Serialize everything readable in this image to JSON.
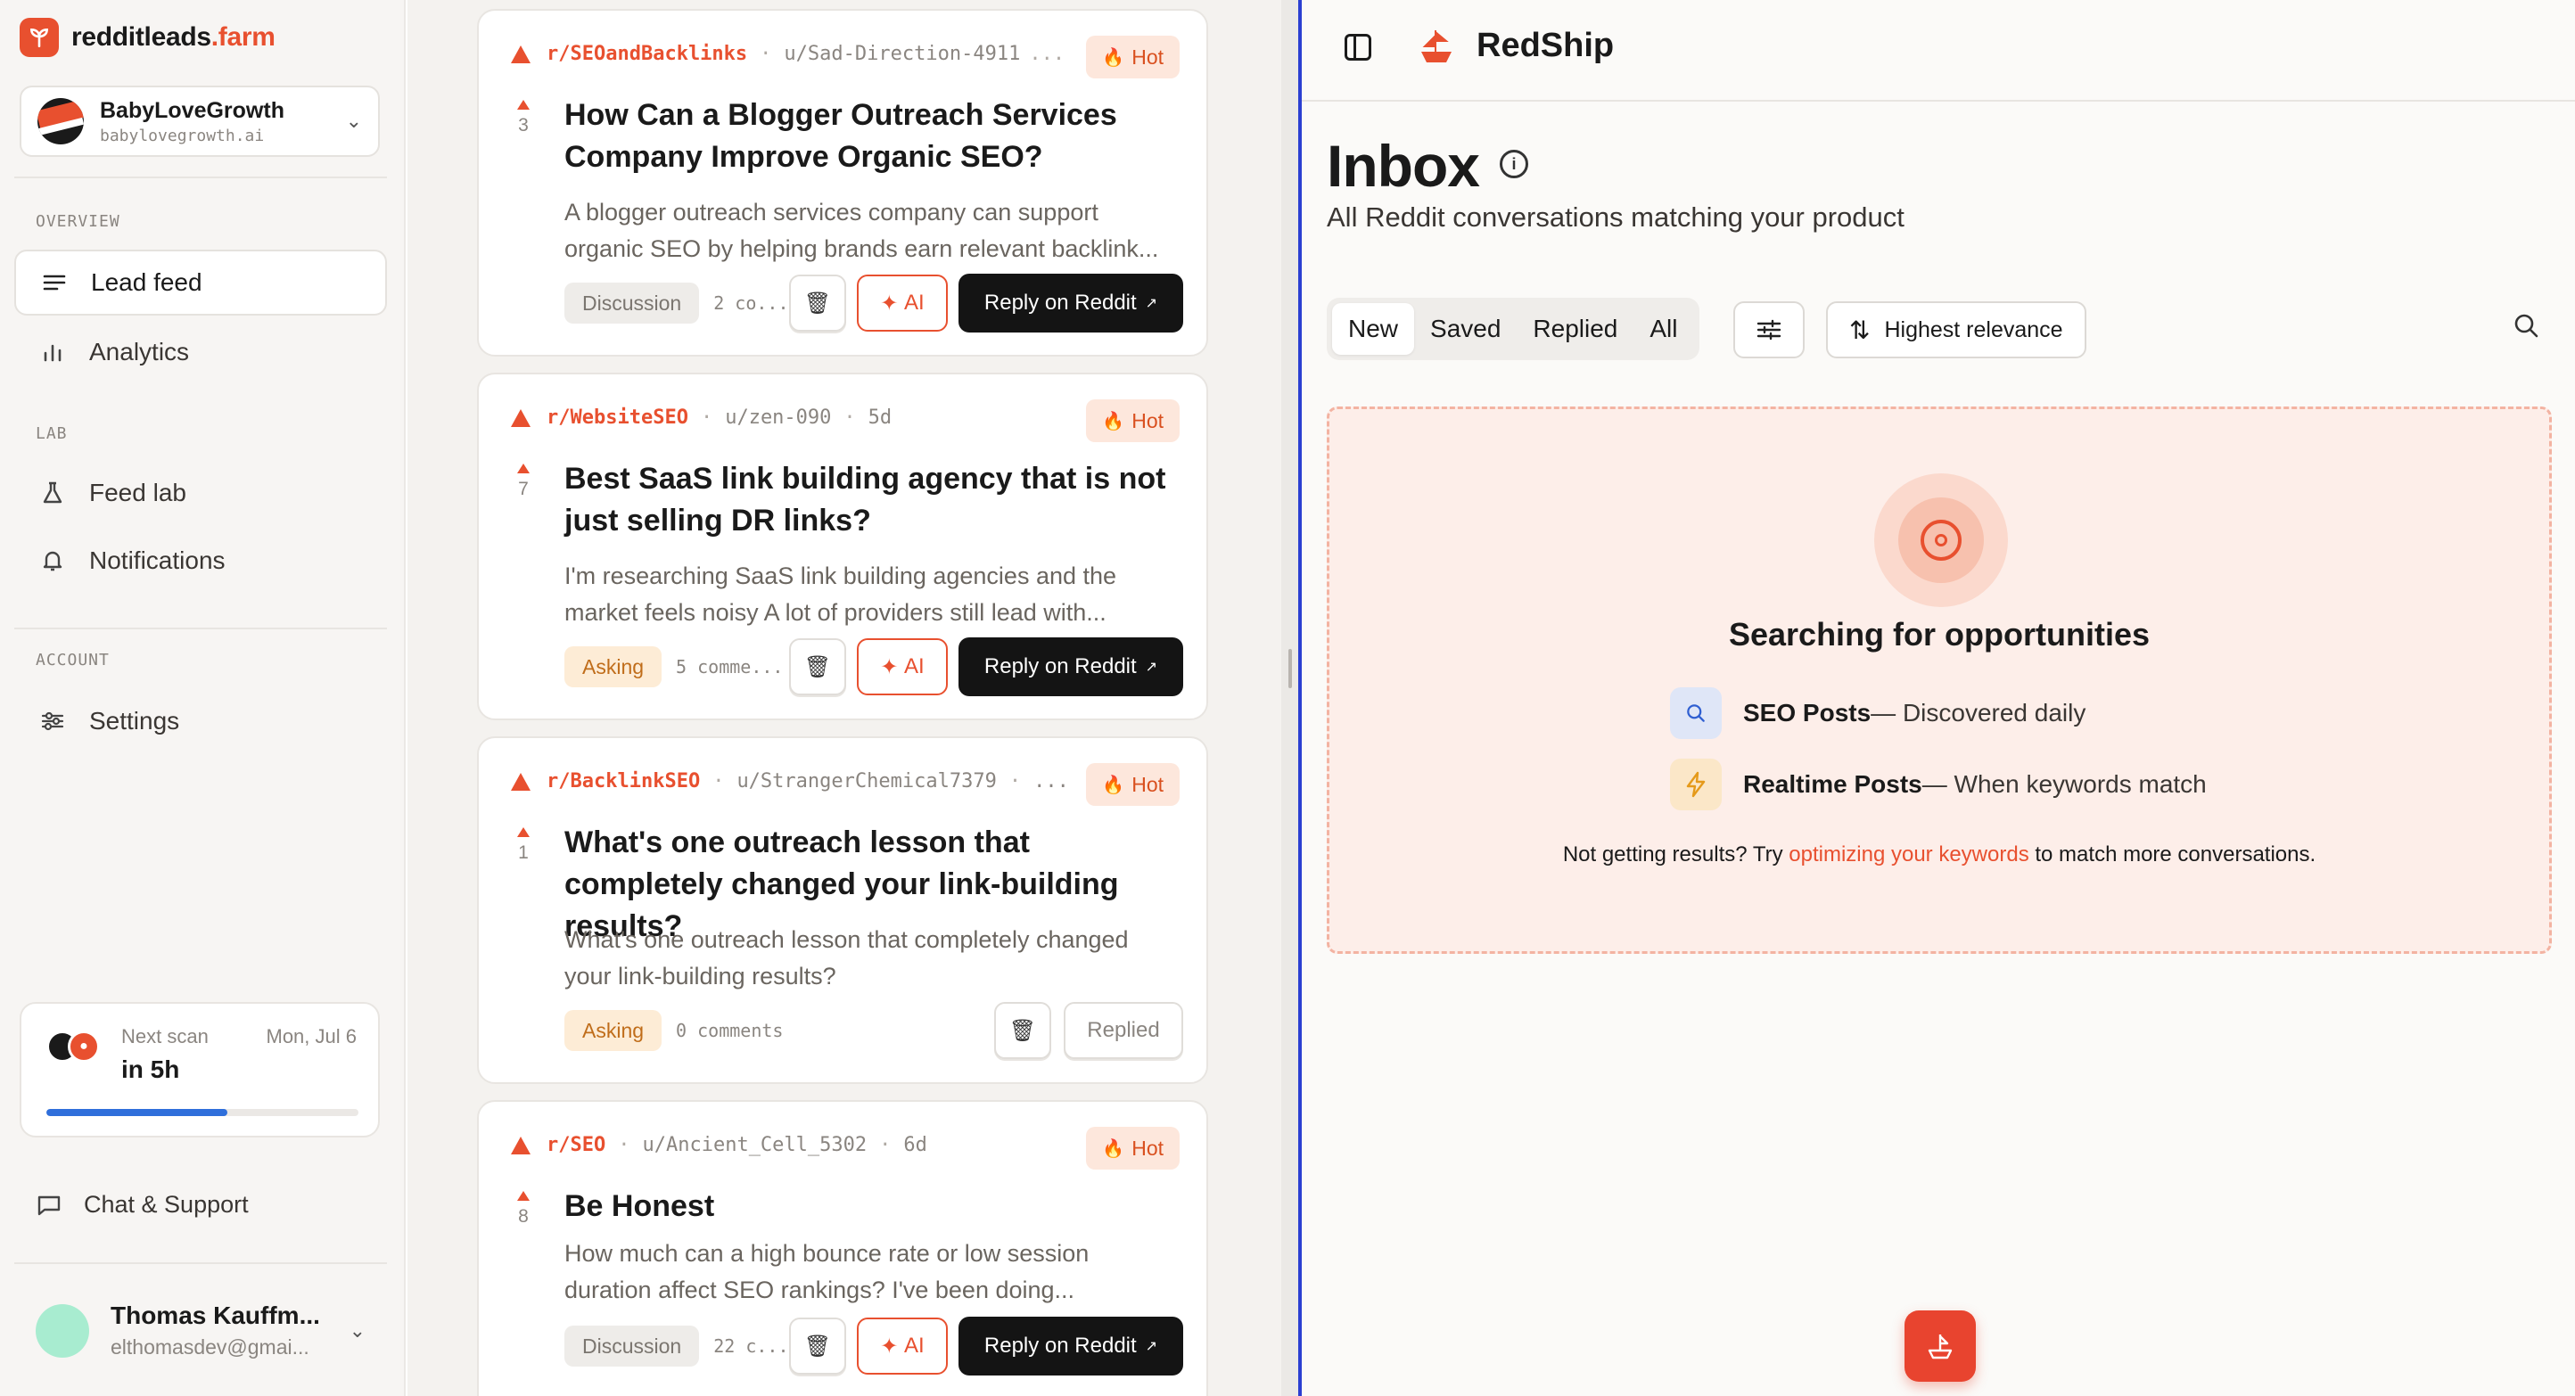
{
  "brand": {
    "name_main": "redditleads",
    "name_accent": ".farm"
  },
  "project": {
    "name": "BabyLoveGrowth",
    "domain": "babylovegrowth.ai"
  },
  "sidebar": {
    "overview_label": "OVERVIEW",
    "lab_label": "LAB",
    "account_label": "ACCOUNT",
    "items": {
      "lead_feed": "Lead feed",
      "analytics": "Analytics",
      "feed_lab": "Feed lab",
      "notifications": "Notifications",
      "settings": "Settings"
    },
    "support": "Chat & Support"
  },
  "scan": {
    "label": "Next scan",
    "date": "Mon, Jul 6",
    "value": "in 5h",
    "progress": 0.58
  },
  "user": {
    "name": "Thomas Kauffm...",
    "email": "elthomasdev@gmai..."
  },
  "posts": [
    {
      "subreddit": "r/SEOandBacklinks",
      "author": "u/Sad-Direction-4911",
      "age": "",
      "hot": "Hot",
      "votes": "3",
      "title": "How Can a Blogger Outreach Services Company Improve Organic SEO?",
      "body": "A blogger outreach services company can support organic SEO by helping brands earn relevant backlink...",
      "tag": "Discussion",
      "comments": "2 co...",
      "ai": "AI",
      "reply": "Reply on Reddit"
    },
    {
      "subreddit": "r/WebsiteSEO",
      "author": "u/zen-090",
      "age": "5d",
      "hot": "Hot",
      "votes": "7",
      "title": "Best SaaS link building agency that is not just selling DR links?",
      "body": "I'm researching SaaS link building agencies and the market feels noisy A lot of providers still lead with...",
      "tag": "Asking",
      "comments": "5 comme...",
      "ai": "AI",
      "reply": "Reply on Reddit"
    },
    {
      "subreddit": "r/BacklinkSEO",
      "author": "u/StrangerChemical7379",
      "age": "",
      "hot": "Hot",
      "votes": "1",
      "title": "What's one outreach lesson that completely changed your link-building results?",
      "body": "What's one outreach lesson that completely changed your link-building results?",
      "tag": "Asking",
      "comments": "0 comments",
      "replied": "Replied"
    },
    {
      "subreddit": "r/SEO",
      "author": "u/Ancient_Cell_5302",
      "age": "6d",
      "hot": "Hot",
      "votes": "8",
      "title": "Be Honest",
      "body": "How much can a high bounce rate or low session duration affect SEO rankings? I've been doing...",
      "tag": "Discussion",
      "comments": "22 c...",
      "ai": "AI",
      "reply": "Reply on Reddit"
    }
  ],
  "panel": {
    "app_name": "RedShip",
    "title": "Inbox",
    "subtitle": "All Reddit conversations matching your product",
    "tabs": [
      "New",
      "Saved",
      "Replied",
      "All"
    ],
    "sort": "Highest relevance",
    "empty": {
      "title": "Searching for opportunities",
      "seo_strong": "SEO Posts",
      "seo_rest": " — Discovered daily",
      "rt_strong": "Realtime Posts",
      "rt_rest": " — When keywords match",
      "hint_pre": "Not getting results? Try ",
      "hint_link": "optimizing your keywords",
      "hint_post": " to match more conversations."
    }
  },
  "colors": {
    "accent": "#e8502f",
    "progress": "#2f6fdb",
    "splitter_edge": "#2b3fd1"
  }
}
